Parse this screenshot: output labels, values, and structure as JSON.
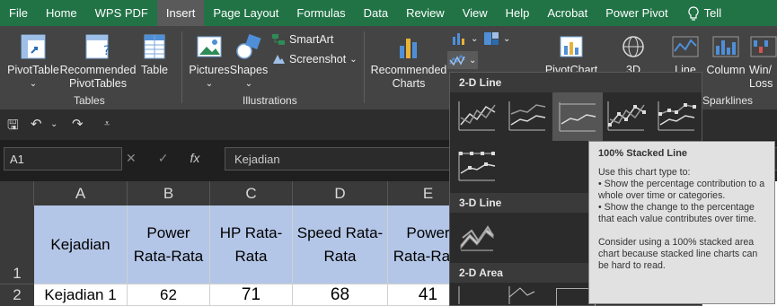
{
  "menubar": {
    "tabs": [
      "File",
      "Home",
      "WPS PDF",
      "Insert",
      "Page Layout",
      "Formulas",
      "Data",
      "Review",
      "View",
      "Help",
      "Acrobat",
      "Power Pivot"
    ],
    "active": "Insert",
    "tell_label": "Tell"
  },
  "ribbon": {
    "pivottable": "PivotTable",
    "recommended_pivot": "Recommended PivotTables",
    "table": "Table",
    "group_tables": "Tables",
    "pictures": "Pictures",
    "shapes": "Shapes",
    "smartart": "SmartArt",
    "screenshot": "Screenshot",
    "group_illustrations": "Illustrations",
    "recommended_charts": "Recommended Charts",
    "pivotchart": "PivotChart",
    "three_d": "3D",
    "line": "Line",
    "column": "Column",
    "winloss": "Win/ Loss",
    "sparklines": "Sparklines"
  },
  "formula_bar": {
    "name_box": "A1",
    "cancel": "✕",
    "enter": "✓",
    "fx": "fx",
    "content": "Kejadian"
  },
  "sheet": {
    "columns": [
      "A",
      "B",
      "C",
      "D",
      "E"
    ],
    "rows": [
      "1",
      "2"
    ],
    "header_row": [
      "Kejadian",
      "Power Rata-Rata",
      "HP Rata-Rata",
      "Speed Rata-Rata",
      "Power Rata-Rata"
    ],
    "data_row": [
      "Kejadian 1",
      "62",
      "71",
      "68",
      "41"
    ]
  },
  "dropdown": {
    "section_2d_line": "2-D Line",
    "section_3d_line": "3-D Line",
    "section_2d_area": "2-D Area"
  },
  "tooltip": {
    "title": "100% Stacked Line",
    "body": "Use this chart type to:\n• Show the percentage contribution to a whole over time or categories.\n• Show the change to the percentage that each value contributes over time.\n\nConsider using a 100% stacked area chart because stacked line charts can be hard to read."
  },
  "colors": {
    "excel_green": "#217346",
    "header_fill": "#b4c6e7"
  }
}
